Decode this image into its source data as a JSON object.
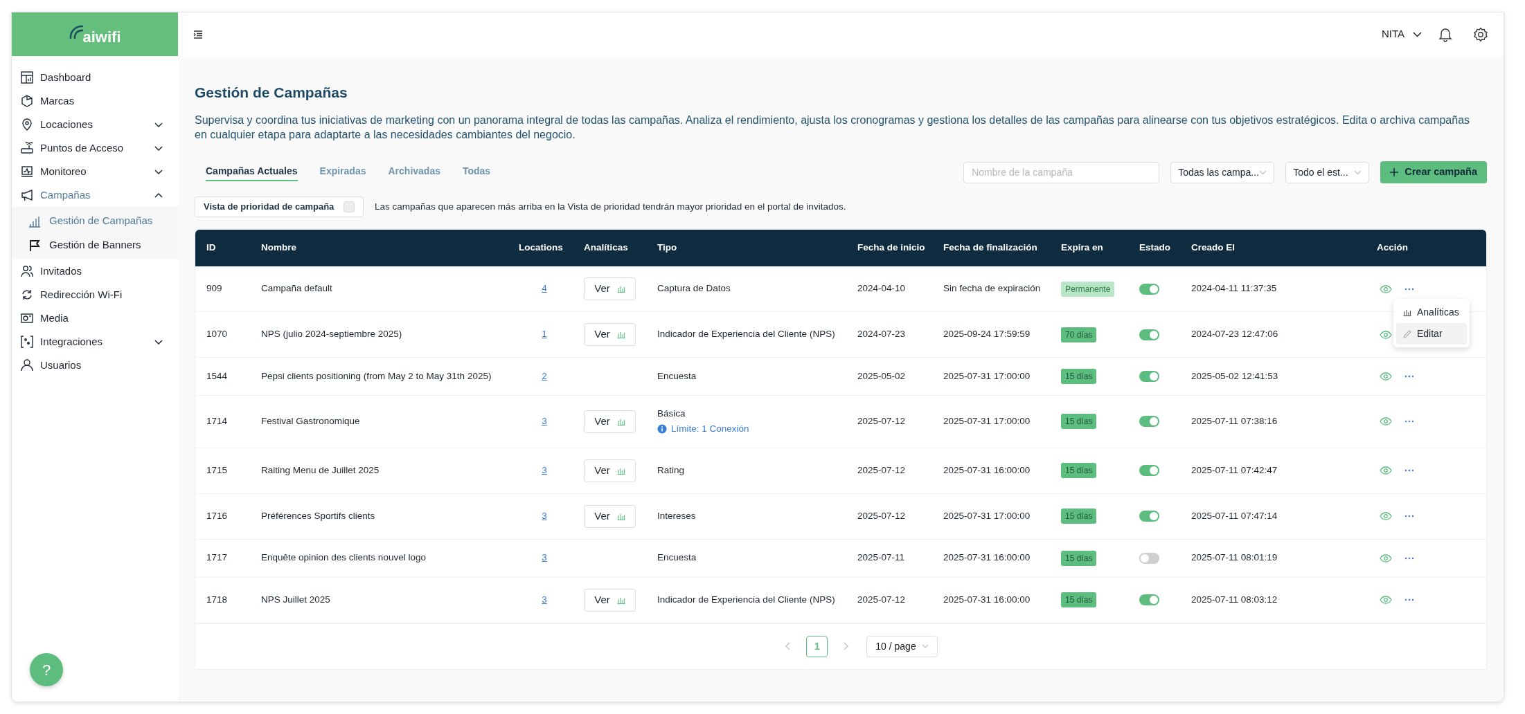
{
  "sidebar": {
    "logo": "aiwifi",
    "items": [
      {
        "label": "Dashboard",
        "selected": false
      },
      {
        "label": "Marcas",
        "selected": false
      },
      {
        "label": "Locaciones",
        "selected": false,
        "expanded": false
      },
      {
        "label": "Puntos de Acceso",
        "selected": false,
        "expanded": false
      },
      {
        "label": "Monitoreo",
        "selected": false,
        "expanded": false
      },
      {
        "label": "Campañas",
        "selected": true,
        "expanded": true,
        "children": [
          {
            "label": "Gestión de Campañas",
            "selected": true
          },
          {
            "label": "Gestión de Banners",
            "selected": false
          }
        ]
      },
      {
        "label": "Invitados",
        "selected": false
      },
      {
        "label": "Redirección Wi-Fi",
        "selected": false
      },
      {
        "label": "Media",
        "selected": false
      },
      {
        "label": "Integraciones",
        "selected": false,
        "expanded": false
      },
      {
        "label": "Usuarios",
        "selected": false
      }
    ]
  },
  "header": {
    "user": "NITA"
  },
  "page": {
    "title": "Gestión de Campañas",
    "description": "Supervisa y coordina tus iniciativas de marketing con un panorama integral de todas las campañas. Analiza el rendimiento, ajusta los cronogramas y gestiona los detalles de las campañas para alinearse con tus objetivos estratégicos. Edita o archiva campañas en cualquier etapa para adaptarte a las necesidades cambiantes del negocio.",
    "tabs": [
      {
        "label": "Campañas Actuales",
        "selected": true
      },
      {
        "label": "Expiradas",
        "selected": false
      },
      {
        "label": "Archivadas",
        "selected": false
      },
      {
        "label": "Todas",
        "selected": false
      }
    ],
    "search": {
      "placeholder": "Nombre de la campaña"
    },
    "filters": [
      {
        "value": "Todas las campa..."
      },
      {
        "value": "Todo el est..."
      }
    ],
    "create_button": "Crear campaña",
    "priority": {
      "label": "Vista de prioridad de campaña",
      "checked": false,
      "note": "Las campañas que aparecen más arriba en la Vista de prioridad tendrán mayor prioridad en el portal de invitados."
    }
  },
  "table": {
    "columns": [
      "ID",
      "Nombre",
      "Locations",
      "Analíticas",
      "Tipo",
      "Fecha de inicio",
      "Fecha de finalización",
      "Expira en",
      "Estado",
      "Creado El",
      "Acción"
    ],
    "rows": [
      {
        "id": "909",
        "name": "Campaña default",
        "locations": "4",
        "analytics": "Ver",
        "type": "Captura de Datos",
        "start": "2024-04-10",
        "end": "Sin fecha de expiración",
        "expires": {
          "label": "Permanente",
          "kind": "permanent"
        },
        "active": true,
        "created": "2024-04-11 11:37:35"
      },
      {
        "id": "1070",
        "name": "NPS (julio 2024-septiembre 2025)",
        "locations": "1",
        "analytics": "Ver",
        "type": "Indicador de Experiencia del Cliente (NPS)",
        "start": "2024-07-23",
        "end": "2025-09-24 17:59:59",
        "expires": {
          "label": "70 días",
          "kind": "days"
        },
        "active": true,
        "created": "2024-07-23 12:47:06"
      },
      {
        "id": "1544",
        "name": "Pepsi clients positioning (from May 2 to May 31th 2025)",
        "locations": "2",
        "type": "Encuesta",
        "start": "2025-05-02",
        "end": "2025-07-31 17:00:00",
        "expires": {
          "label": "15 días",
          "kind": "days"
        },
        "active": true,
        "created": "2025-05-02 12:41:53"
      },
      {
        "id": "1714",
        "name": "Festival Gastronomique",
        "locations": "3",
        "analytics": "Ver",
        "type": "Básica",
        "type_note": "Límite: 1 Conexión",
        "start": "2025-07-12",
        "end": "2025-07-31 17:00:00",
        "expires": {
          "label": "15 días",
          "kind": "days"
        },
        "active": true,
        "created": "2025-07-11 07:38:16"
      },
      {
        "id": "1715",
        "name": "Raiting Menu de Juillet 2025",
        "locations": "3",
        "analytics": "Ver",
        "type": "Rating",
        "start": "2025-07-12",
        "end": "2025-07-31 16:00:00",
        "expires": {
          "label": "15 días",
          "kind": "days"
        },
        "active": true,
        "created": "2025-07-11 07:42:47"
      },
      {
        "id": "1716",
        "name": "Préférences Sportifs clients",
        "locations": "3",
        "analytics": "Ver",
        "type": "Intereses",
        "start": "2025-07-12",
        "end": "2025-07-31 17:00:00",
        "expires": {
          "label": "15 días",
          "kind": "days"
        },
        "active": true,
        "created": "2025-07-11 07:47:14"
      },
      {
        "id": "1717",
        "name": "Enquête opinion des clients nouvel logo",
        "locations": "3",
        "type": "Encuesta",
        "start": "2025-07-11",
        "end": "2025-07-31 16:00:00",
        "expires": {
          "label": "15 días",
          "kind": "days"
        },
        "active": false,
        "created": "2025-07-11 08:01:19"
      },
      {
        "id": "1718",
        "name": "NPS Juillet 2025",
        "locations": "3",
        "analytics": "Ver",
        "type": "Indicador de Experiencia del Cliente (NPS)",
        "start": "2025-07-12",
        "end": "2025-07-31 16:00:00",
        "expires": {
          "label": "15 días",
          "kind": "days"
        },
        "active": true,
        "created": "2025-07-11 08:03:12"
      }
    ],
    "action_menu": {
      "items": [
        {
          "label": "Analíticas",
          "selected": false
        },
        {
          "label": "Editar",
          "selected": true
        }
      ]
    }
  },
  "pagination": {
    "pages": [
      {
        "label": "1",
        "selected": true
      }
    ],
    "page_size": "10 / page"
  },
  "help_button": "?"
}
